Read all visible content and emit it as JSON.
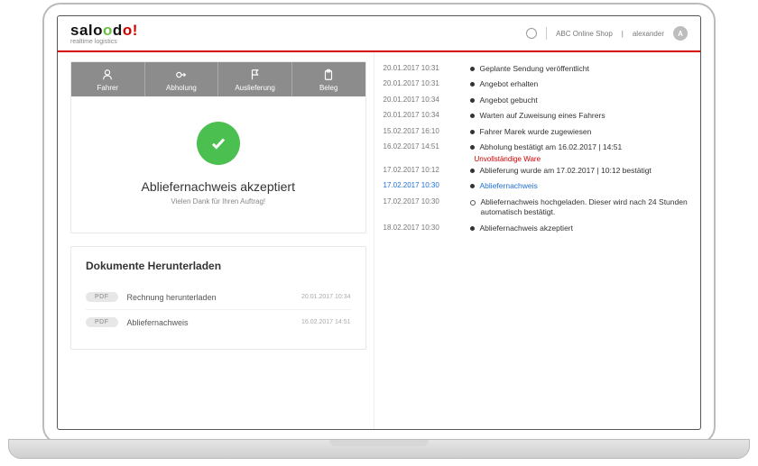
{
  "brand": {
    "name_prefix": "salo",
    "name_green": "o",
    "name_mid": "d",
    "name_red": "o!",
    "tagline": "realtime logistics"
  },
  "header": {
    "shop": "ABC Online Shop",
    "user": "alexander",
    "avatar_initial": "A"
  },
  "tabs": [
    {
      "label": "Fahrer"
    },
    {
      "label": "Abholung"
    },
    {
      "label": "Auslieferung"
    },
    {
      "label": "Beleg"
    }
  ],
  "confirmation": {
    "title": "Abliefernachweis akzeptiert",
    "subtitle": "Vielen Dank für Ihren Auftrag!"
  },
  "documents": {
    "heading": "Dokumente Herunterladen",
    "badge": "PDF",
    "items": [
      {
        "name": "Rechnung herunterladen",
        "date": "20.01.2017 10:34"
      },
      {
        "name": "Abliefernachweis",
        "date": "16.02.2017 14:51"
      }
    ]
  },
  "timeline": [
    {
      "date": "20.01.2017 10:31",
      "text": "Geplante Sendung veröffentlicht"
    },
    {
      "date": "20.01.2017 10:31",
      "text": "Angebot erhalten"
    },
    {
      "date": "20.01.2017 10:34",
      "text": "Angebot gebucht"
    },
    {
      "date": "20.01.2017 10:34",
      "text": "Warten auf Zuweisung eines Fahrers"
    },
    {
      "date": "15.02.2017 16:10",
      "text": "Fahrer Marek wurde zugewiesen"
    },
    {
      "date": "16.02.2017 14:51",
      "text": "Abholung bestätigt am 16.02.2017 | 14:51",
      "sub": "Unvollständige Ware",
      "sub_style": "red"
    },
    {
      "date": "17.02.2017 10:12",
      "text": "Ablieferung wurde am 17.02.2017 | 10:12 bestätigt"
    },
    {
      "date": "17.02.2017 10:30",
      "text": "Abliefernachweis",
      "text_style": "blue",
      "date_style": "blue"
    },
    {
      "date": "17.02.2017 10:30",
      "text": "Abliefernachweis hochgeladen. Dieser wird nach 24 Stunden automatisch bestätigt.",
      "hollow": true
    },
    {
      "date": "18.02.2017 10:30",
      "text": "Abliefernachweis akzeptiert"
    }
  ]
}
